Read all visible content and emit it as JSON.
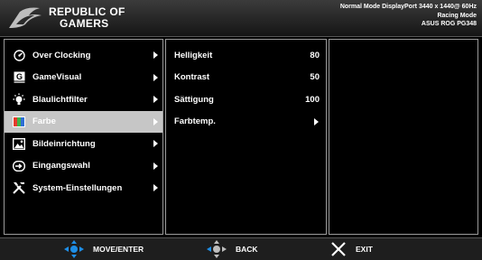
{
  "header": {
    "brand_line1": "REPUBLIC OF",
    "brand_line2": "GAMERS",
    "status_line1": "Normal Mode DisplayPort 3440 x 1440@ 60Hz",
    "status_line2": "Racing Mode",
    "status_line3": "ASUS ROG PG348"
  },
  "main_menu": [
    {
      "label": "Over Clocking",
      "icon": "speedometer-icon"
    },
    {
      "label": "GameVisual",
      "icon": "gamevisual-icon"
    },
    {
      "label": "Blaulichtfilter",
      "icon": "bulb-icon"
    },
    {
      "label": "Farbe",
      "icon": "color-palette-icon",
      "selected": true
    },
    {
      "label": "Bildeinrichtung",
      "icon": "image-setup-icon"
    },
    {
      "label": "Eingangswahl",
      "icon": "input-select-icon"
    },
    {
      "label": "System-Einstellungen",
      "icon": "wrench-icon"
    }
  ],
  "sub_menu": [
    {
      "label": "Helligkeit",
      "value": "80"
    },
    {
      "label": "Kontrast",
      "value": "50"
    },
    {
      "label": "Sättigung",
      "value": "100"
    },
    {
      "label": "Farbtemp.",
      "value": ""
    }
  ],
  "footer": {
    "move_label": "MOVE/ENTER",
    "back_label": "BACK",
    "exit_label": "EXIT"
  },
  "colors": {
    "accent_blue": "#1e8ee6",
    "selected_bg": "#c6c6c6"
  }
}
